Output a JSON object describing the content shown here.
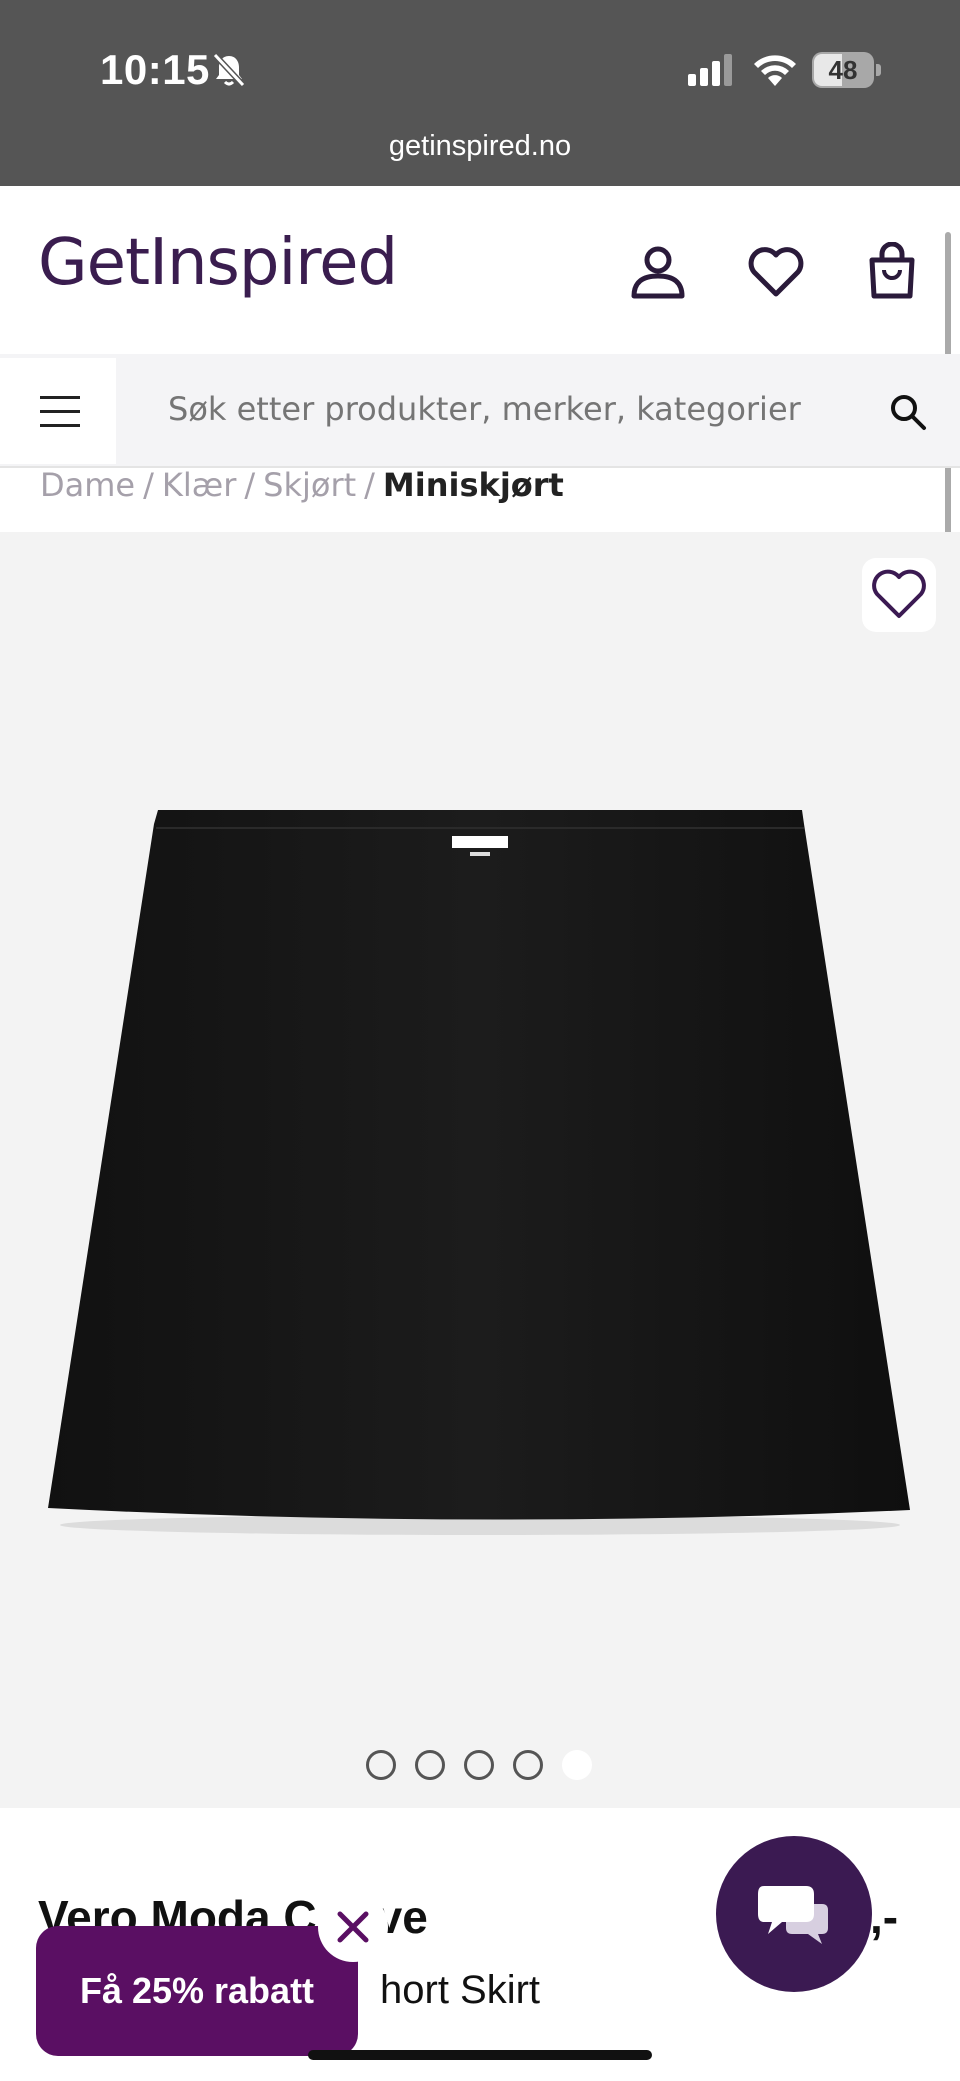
{
  "status_bar": {
    "time": "10:15",
    "battery": "48",
    "url": "getinspired.no"
  },
  "header": {
    "logo": "GetInspired",
    "icons": [
      "user-icon",
      "heart-icon",
      "shopping-bag-icon"
    ]
  },
  "search": {
    "placeholder": "Søk etter produkter, merker, kategorier"
  },
  "breadcrumb": {
    "items": [
      "Dame",
      "Klær",
      "Skjørt"
    ],
    "current": "Miniskjørt"
  },
  "gallery": {
    "image_count": 5,
    "active_index": 4
  },
  "product": {
    "title": "Vero Moda C",
    "title_end": "ve",
    "subtitle": "hort Skirt",
    "price": ",-"
  },
  "discount_banner": {
    "label": "Få 25% rabatt"
  },
  "colors": {
    "brand": "#3b1a52",
    "discount": "#5a0f63",
    "status_bar": "#555555"
  }
}
